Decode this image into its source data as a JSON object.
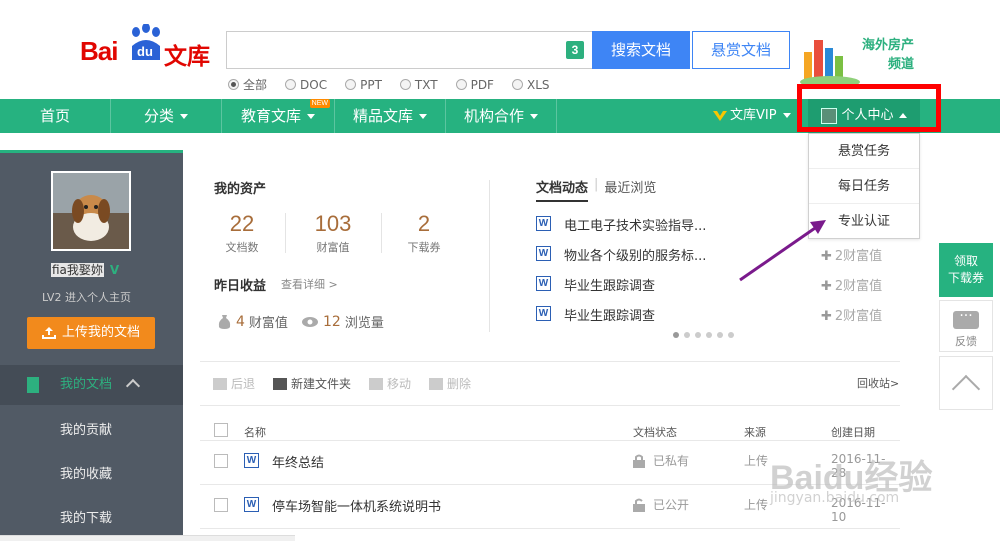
{
  "header": {
    "logo_bai": "Bai",
    "logo_du": "du",
    "logo_wenku": "文库",
    "search_value": "",
    "search_badge": "3",
    "search_button": "搜索文档",
    "bounty_button": "悬赏文档",
    "filters": [
      {
        "label": "全部",
        "selected": true
      },
      {
        "label": "DOC",
        "selected": false
      },
      {
        "label": "PPT",
        "selected": false
      },
      {
        "label": "TXT",
        "selected": false
      },
      {
        "label": "PDF",
        "selected": false
      },
      {
        "label": "XLS",
        "selected": false
      }
    ],
    "ad_line1": "海外房产",
    "ad_line2": "频道"
  },
  "nav": {
    "items": [
      "首页",
      "分类",
      "教育文库",
      "精品文库",
      "机构合作"
    ],
    "new_tag": "NEW",
    "vip": "文库VIP",
    "user_center": "个人中心"
  },
  "dropdown": {
    "items": [
      "悬赏任务",
      "每日任务",
      "专业认证"
    ]
  },
  "sidebar": {
    "username": "fia我娶妳",
    "verified_mark": "V",
    "level_text": "LV2  进入个人主页",
    "upload_button": "上传我的文档",
    "menu_head": "我的文档",
    "sub_items": [
      "我的贡献",
      "我的收藏",
      "我的下载"
    ]
  },
  "assets": {
    "title": "我的资产",
    "stats": [
      {
        "value": "22",
        "label": "文档数"
      },
      {
        "value": "103",
        "label": "财富值"
      },
      {
        "value": "2",
        "label": "下载券"
      }
    ],
    "yesterday_title": "昨日收益",
    "detail_link": "查看详细  >",
    "earn_wealth_value": "4",
    "earn_wealth_label": "财富值",
    "earn_views_value": "12",
    "earn_views_label": "浏览量"
  },
  "activity": {
    "tab_active": "文档动态",
    "tab_other": "最近浏览",
    "rows": [
      {
        "title": "电工电子技术实验指导...",
        "reward": ""
      },
      {
        "title": "物业各个级别的服务标...",
        "reward": "2财富值"
      },
      {
        "title": "毕业生跟踪调查",
        "reward": "2财富值"
      },
      {
        "title": "毕业生跟踪调查",
        "reward": "2财富值"
      }
    ],
    "carousel_active_index": 0,
    "carousel_count": 6
  },
  "toolbar": {
    "back": "后退",
    "new_folder": "新建文件夹",
    "move": "移动",
    "delete": "删除",
    "recycle": "回收站>"
  },
  "table": {
    "headers": {
      "name": "名称",
      "state": "文档状态",
      "source": "来源",
      "date": "创建日期"
    },
    "rows": [
      {
        "name": "年终总结",
        "state": "已私有",
        "source": "上传",
        "date": "2016-11-28"
      },
      {
        "name": "停车场智能一体机系统说明书",
        "state": "已公开",
        "source": "上传",
        "date": "2016-11-10"
      }
    ]
  },
  "floating": {
    "claim_line1": "领取",
    "claim_line2": "下载券",
    "feedback": "反馈"
  },
  "watermark": {
    "line1": "Baidu经验",
    "line2": "jingyan.baidu.com"
  },
  "colors": {
    "brand_green": "#26b280",
    "brand_red": "#e10601",
    "search_blue": "#3e85f5",
    "upload_orange": "#f28a1c",
    "highlight_red": "#ff0000",
    "arrow_purple": "#7a1a8c"
  }
}
